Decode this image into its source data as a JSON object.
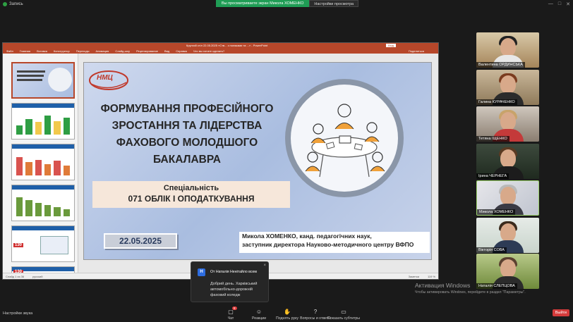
{
  "topbar": {
    "recording_label": "Запись",
    "share_message": "Вы просматриваете экран Микола ХОМЕНКО",
    "view_options": "Настройки просмотра",
    "window_controls": [
      "—",
      "□",
      "✕"
    ]
  },
  "ppt": {
    "window_title": "Круглий стіл 22.05.2025 «Ств... з поляками та ...» - PowerPoint",
    "sign_in": "Вхід",
    "ribbon_tabs": [
      "Файл",
      "Главная",
      "Вставка",
      "Конструктор",
      "Переходы",
      "Анимация",
      "Слайд-шоу",
      "Рецензирование",
      "Вид",
      "Справка",
      "Что вы хотите сделать?"
    ],
    "ribbon_share": "Поделиться",
    "thumb_numbers": [
      "1",
      "2",
      "3",
      "4",
      "5",
      "6",
      "7"
    ],
    "thumb_badges": [
      "130",
      "130"
    ],
    "status_left": "Слайд 1 из 36",
    "status_lang": "русский",
    "status_notes": "Заметки",
    "status_zoom": "119 %"
  },
  "slide": {
    "logo_text": "НМЦ",
    "title_lines": [
      "ФОРМУВАННЯ ПРОФЕСІЙНОГО",
      "ЗРОСТАННЯ ТА ЛІДЕРСТВА",
      "ФАХОВОГО МОЛОДШОГО",
      "БАКАЛАВРА"
    ],
    "spec_label": "Спеціальність",
    "spec_value": "071 ОБЛІК І ОПОДАТКУВАННЯ",
    "date": "22.05.2025",
    "author_line1": "Микола ХОМЕНКО, канд. педагогічних наук,",
    "author_line2": "заступник директора Науково-методичного центру ВФПО"
  },
  "participants": [
    {
      "name": "Валентина ОРДИНСЬКА"
    },
    {
      "name": "Галина КУРАЧЕНКО"
    },
    {
      "name": "Тетяна ІЩЕНКО"
    },
    {
      "name": "Ірина ЧЕРНЕГА"
    },
    {
      "name": "Микола ХОМЕНКО",
      "active": true
    },
    {
      "name": "Вікторія СОВА"
    },
    {
      "name": "Наталія СЛЕПЦОВА"
    }
  ],
  "chat_popup": {
    "avatar": "Н",
    "from": "От Наталія Ненітайло всем",
    "message": "Добрий день. Харківський автомобільно-дорожній фаховий коледж",
    "close": "×"
  },
  "activation": {
    "title": "Активация Windows",
    "subtitle": "Чтобы активировать Windows, перейдите в раздел \"Параметры\"."
  },
  "toolbar": {
    "sound_settings": "Настройки звука",
    "chat": "Чат",
    "chat_count": "8",
    "reactions": "Реакции",
    "raise_hand": "Поднять руку",
    "qa": "Вопросы и ответы",
    "captions": "Показать субтитры",
    "exit": "Выйти"
  },
  "colors": {
    "ppt_accent": "#b7472a",
    "share_green": "#1f9d55",
    "exit_red": "#d43b3b",
    "active_tile_border": "#9cd36b"
  }
}
